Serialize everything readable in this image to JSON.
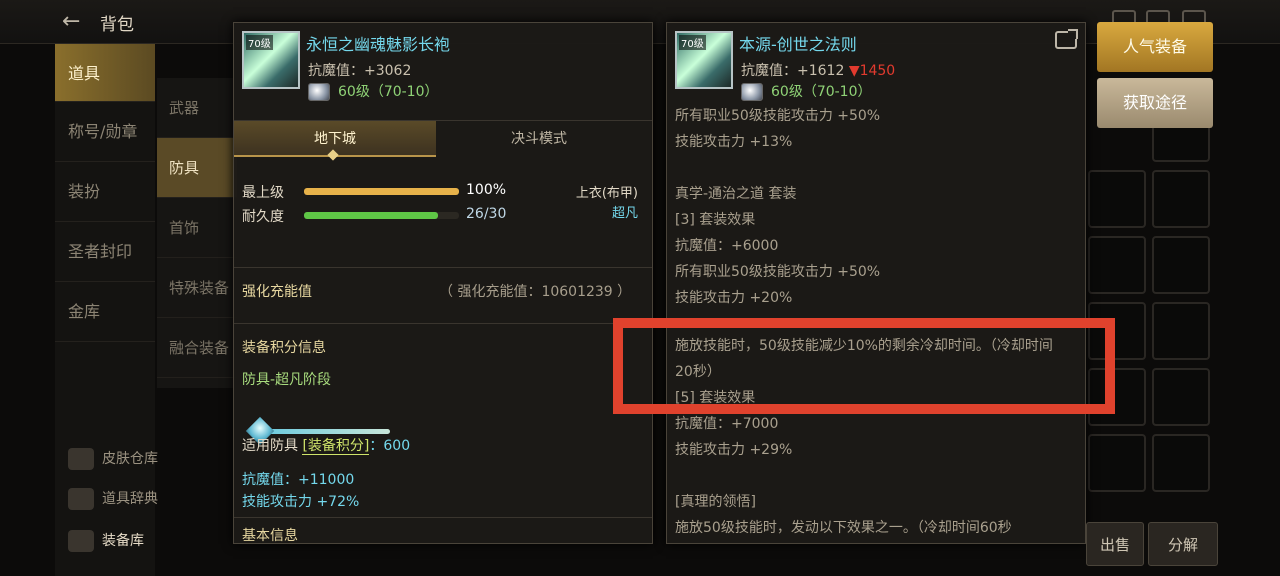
{
  "header": {
    "back_glyph": "←",
    "title": "背包"
  },
  "sidebar": {
    "items": [
      "道具",
      "称号/勋章",
      "装扮",
      "圣者封印",
      "金库"
    ],
    "active": "道具"
  },
  "categories": {
    "items": [
      "武器",
      "防具",
      "首饰",
      "特殊装备",
      "融合装备"
    ],
    "active": "防具"
  },
  "sidebar_bottom": [
    "皮肤仓库",
    "道具辞典",
    "装备库"
  ],
  "left_item": {
    "icon_label": "70级",
    "name": "永恒之幽魂魅影长袍",
    "resist": "抗魔值：+3062",
    "req": "60级（70-10）",
    "tabs": [
      "地下城",
      "决斗模式"
    ],
    "active_tab": "地下城",
    "rows": [
      {
        "label": "最上级",
        "value": "100%",
        "fill": 1.0,
        "color": "#e7b24a"
      },
      {
        "label": "耐久度",
        "value": "26/30",
        "fill": 0.8667,
        "color": "#5fc646"
      }
    ],
    "slot": "上衣(布甲)",
    "rarity": "超凡",
    "enhance_label": "强化充能值",
    "enhance_value": "（ 强化充能值：10601239 ）",
    "score_title": "装备积分信息",
    "score_stage": "防具-超凡阶段",
    "applicable_prefix": "适用防具",
    "applicable_tag": "[装备积分]",
    "applicable_value": "：600",
    "bonus_resist": "抗魔值：+11000",
    "bonus_skill": "技能攻击力 +72%",
    "basic_title": "基本信息"
  },
  "right_item": {
    "icon_label": "70级",
    "name": "本源-创世之法则",
    "resist": "抗魔值：+1612",
    "resist_diff": "▼1450",
    "req": "60级（70-10）",
    "lines": [
      "所有职业50级技能攻击力 +50%",
      "技能攻击力 +13%",
      "",
      "真学-通治之道 套装",
      "[3] 套装效果",
      "抗魔值：+6000",
      "所有职业50级技能攻击力 +50%",
      "技能攻击力 +20%",
      ""
    ],
    "highlight_text": "施放技能时，50级技能减少10%的剩余冷却时间。（冷却时间20秒）",
    "lines_after": [
      "[5] 套装效果",
      "抗魔值：+7000",
      "技能攻击力 +29%",
      "",
      "[真理的领悟]",
      "施放50级技能时，发动以下效果之一。（冷却时间60秒"
    ]
  },
  "buttons": {
    "popular": "人气装备",
    "source": "获取途径",
    "sell": "出售",
    "decompose": "分解"
  },
  "colors": {
    "highlight_box": "#e0422d",
    "accent_gold": "#d9a93f",
    "item_name": "#74d8ec"
  }
}
